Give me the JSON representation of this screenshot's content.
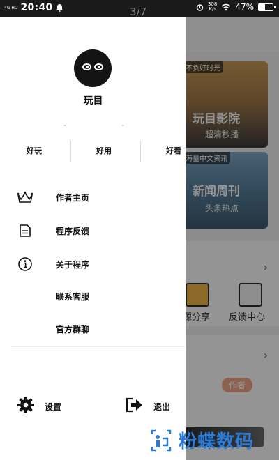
{
  "status_bar": {
    "network": "4G HD",
    "time": "20:40",
    "speed_value": "308",
    "speed_unit": "K/s",
    "battery": "47%",
    "battery_level": 0.47
  },
  "pager": {
    "indicator": "3/7"
  },
  "background": {
    "banner1": {
      "tag": "不负好时光",
      "title": "玩目影院",
      "subtitle": "超清秒播"
    },
    "banner2": {
      "tag": "海量中文资讯",
      "title": "新闻周刊",
      "subtitle": "头条热点"
    },
    "tools": [
      {
        "label": "源分享"
      },
      {
        "label": "反馈中心"
      }
    ],
    "author_badge": "作者",
    "chevron": "›"
  },
  "drawer": {
    "username": "玩目",
    "stats": [
      "好玩",
      "好用",
      "好看"
    ],
    "menu": [
      {
        "label": "作者主页",
        "icon": "crown-icon"
      },
      {
        "label": "程序反馈",
        "icon": "document-icon"
      },
      {
        "label": "关于程序",
        "icon": "info-icon"
      },
      {
        "label": "联系客服",
        "icon": ""
      },
      {
        "label": "官方群聊",
        "icon": ""
      }
    ],
    "settings_label": "设置",
    "logout_label": "退出"
  },
  "watermark": {
    "text": "粉蝶数码"
  },
  "colors": {
    "accent_blue": "#2b7cd8",
    "badge": "#f1a88a",
    "overlay": "rgba(0,0,0,0.42)"
  }
}
